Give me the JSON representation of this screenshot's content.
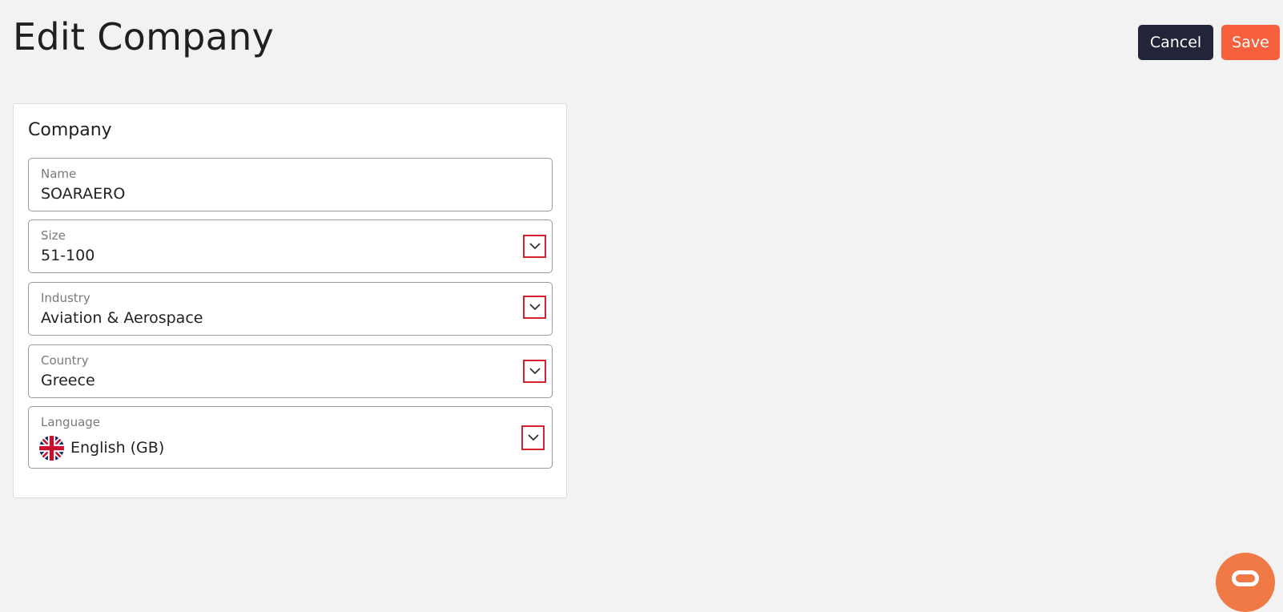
{
  "header": {
    "title": "Edit Company",
    "cancel_label": "Cancel",
    "save_label": "Save"
  },
  "colors": {
    "cancel_bg": "#22243a",
    "save_bg": "#f6603c",
    "highlight_border": "#d3232f",
    "page_bg": "#f2f2f2"
  },
  "card": {
    "title": "Company",
    "fields": {
      "name": {
        "label": "Name",
        "value": "SOARAERO"
      },
      "size": {
        "label": "Size",
        "value": "51-100",
        "icon": "chevron-down-icon"
      },
      "industry": {
        "label": "Industry",
        "value": "Aviation & Aerospace",
        "icon": "chevron-down-icon"
      },
      "country": {
        "label": "Country",
        "value": "Greece",
        "icon": "chevron-down-icon"
      },
      "language": {
        "label": "Language",
        "value": "English (GB)",
        "flag_icon": "uk-flag-icon",
        "icon": "chevron-down-icon"
      }
    }
  },
  "chat_widget": {
    "icon": "chat-icon"
  }
}
